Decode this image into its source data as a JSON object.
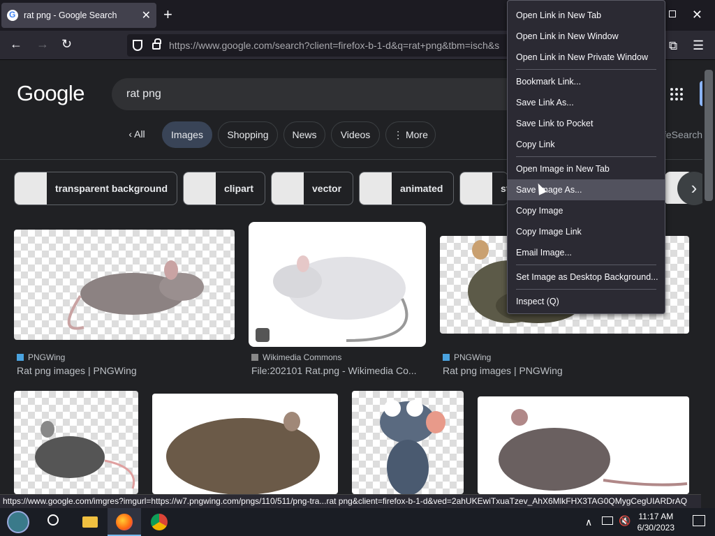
{
  "tab": {
    "title": "rat png - Google Search",
    "close": "✕",
    "new_tab": "+"
  },
  "window": {
    "close": "✕"
  },
  "nav": {
    "url": "https://www.google.com/search?client=firefox-b-1-d&q=rat+png&tbm=isch&s",
    "back": "←",
    "forward": "→",
    "reload": "↻"
  },
  "google": {
    "logo": "Google",
    "query": "rat png",
    "chips": [
      {
        "label": "All",
        "prefix": "‹ "
      },
      {
        "label": "Images"
      },
      {
        "label": "Shopping"
      },
      {
        "label": "News"
      },
      {
        "label": "Videos"
      },
      {
        "label": "More",
        "prefix": "⋮ "
      }
    ],
    "safesearch": "feSearch",
    "related": [
      "transparent background",
      "clipart",
      "vector",
      "animated",
      "st"
    ],
    "related_next": "›"
  },
  "results": [
    {
      "source": "PNGWing",
      "caption": "Rat png images | PNGWing"
    },
    {
      "source": "Wikimedia Commons",
      "caption": "File:202101 Rat.png - Wikimedia Co..."
    },
    {
      "source": "PNGWing",
      "caption": "Rat png images | PNGWing"
    }
  ],
  "status_url": "https://www.google.com/imgres?imgurl=https://w7.pngwing.com/pngs/110/511/png-tra...rat png&client=firefox-b-1-d&ved=2ahUKEwiTxuaTzev_AhX6MlkFHX3TAG0QMygCegUIARDrAQ",
  "context_menu": {
    "items": [
      "Open Link in New Tab",
      "Open Link in New Window",
      "Open Link in New Private Window",
      "---",
      "Bookmark Link...",
      "Save Link As...",
      "Save Link to Pocket",
      "Copy Link",
      "---",
      "Open Image in New Tab",
      "Save Image As...",
      "Copy Image",
      "Copy Image Link",
      "Email Image...",
      "---",
      "Set Image as Desktop Background...",
      "---",
      "Inspect (Q)"
    ],
    "hovered": "Save Image As..."
  },
  "clock": {
    "time": "11:17 AM",
    "date": "6/30/2023"
  }
}
